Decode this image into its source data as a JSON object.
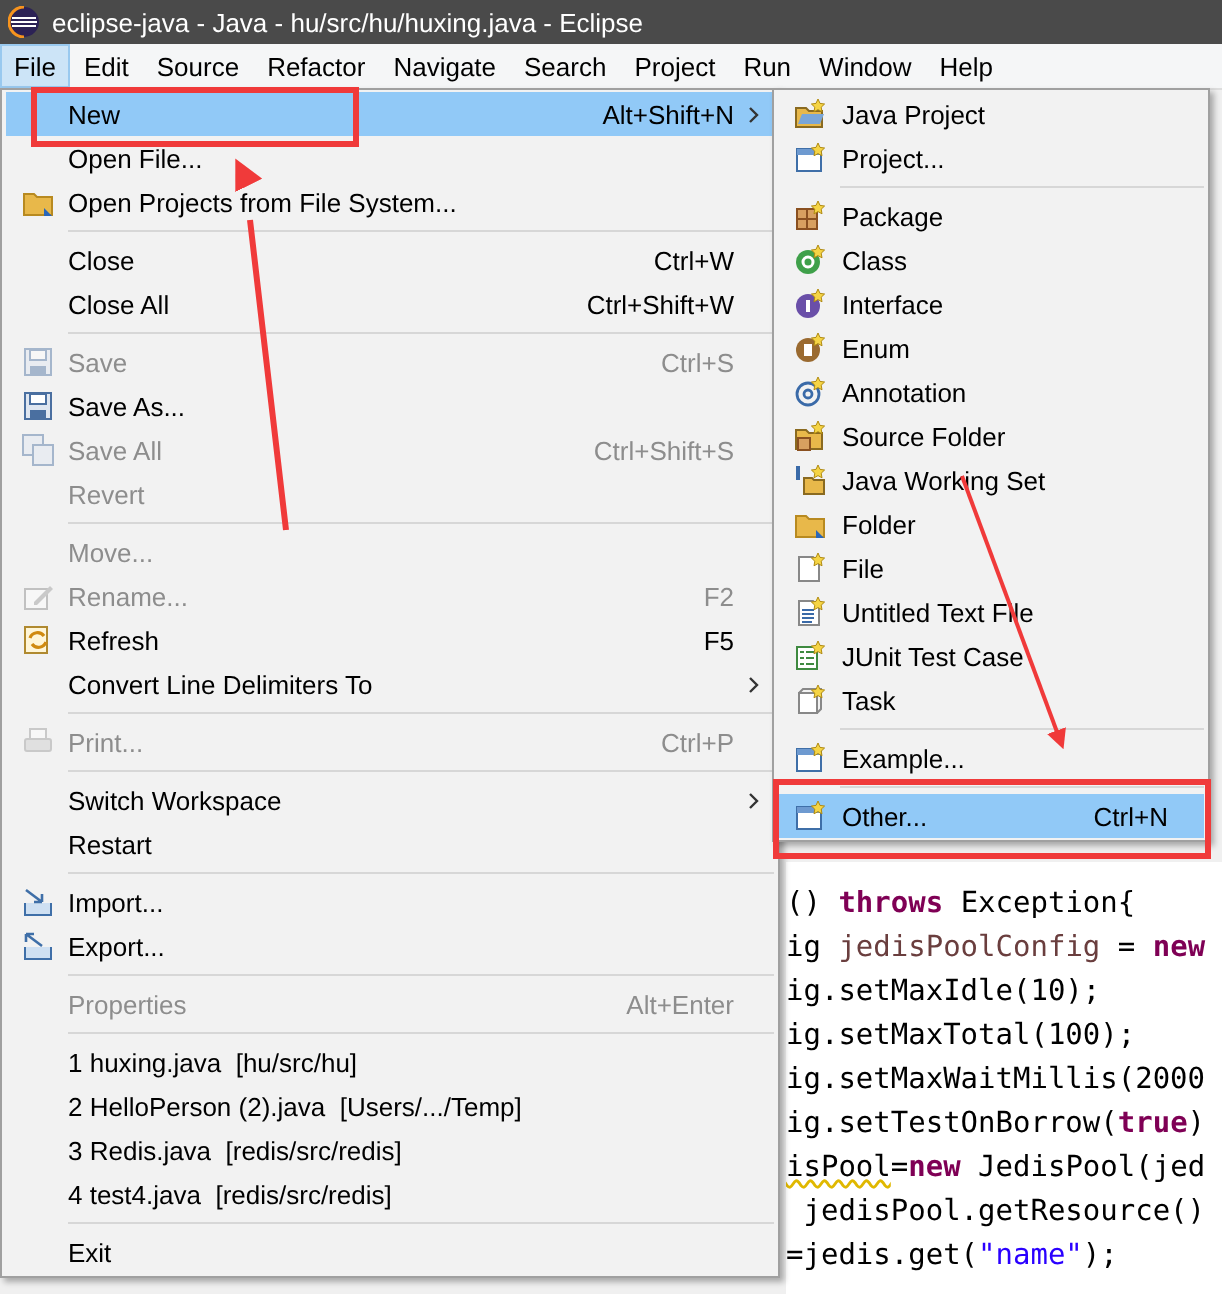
{
  "window": {
    "title": "eclipse-java - Java - hu/src/hu/huxing.java - Eclipse"
  },
  "menubar": [
    {
      "label": "File",
      "selected": true
    },
    {
      "label": "Edit",
      "selected": false
    },
    {
      "label": "Source",
      "selected": false
    },
    {
      "label": "Refactor",
      "selected": false
    },
    {
      "label": "Navigate",
      "selected": false
    },
    {
      "label": "Search",
      "selected": false
    },
    {
      "label": "Project",
      "selected": false
    },
    {
      "label": "Run",
      "selected": false
    },
    {
      "label": "Window",
      "selected": false
    },
    {
      "label": "Help",
      "selected": false
    }
  ],
  "file_menu": {
    "items": [
      {
        "kind": "item",
        "label": "New",
        "shortcut": "Alt+Shift+N",
        "submenu": true,
        "selected": true,
        "disabled": false
      },
      {
        "kind": "item",
        "label": "Open File...",
        "submenu": false,
        "selected": false,
        "disabled": false
      },
      {
        "kind": "item",
        "label": "Open Projects from File System...",
        "submenu": false,
        "selected": false,
        "disabled": false
      },
      {
        "kind": "separator"
      },
      {
        "kind": "item",
        "label": "Close",
        "shortcut": "Ctrl+W",
        "submenu": false,
        "selected": false,
        "disabled": false
      },
      {
        "kind": "item",
        "label": "Close All",
        "shortcut": "Ctrl+Shift+W",
        "submenu": false,
        "selected": false,
        "disabled": false
      },
      {
        "kind": "separator"
      },
      {
        "kind": "item",
        "label": "Save",
        "shortcut": "Ctrl+S",
        "submenu": false,
        "selected": false,
        "disabled": true
      },
      {
        "kind": "item",
        "label": "Save As...",
        "submenu": false,
        "selected": false,
        "disabled": false
      },
      {
        "kind": "item",
        "label": "Save All",
        "shortcut": "Ctrl+Shift+S",
        "submenu": false,
        "selected": false,
        "disabled": true
      },
      {
        "kind": "item",
        "label": "Revert",
        "submenu": false,
        "selected": false,
        "disabled": true
      },
      {
        "kind": "separator"
      },
      {
        "kind": "item",
        "label": "Move...",
        "submenu": false,
        "selected": false,
        "disabled": true
      },
      {
        "kind": "item",
        "label": "Rename...",
        "shortcut": "F2",
        "submenu": false,
        "selected": false,
        "disabled": true
      },
      {
        "kind": "item",
        "label": "Refresh",
        "shortcut": "F5",
        "submenu": false,
        "selected": false,
        "disabled": false
      },
      {
        "kind": "item",
        "label": "Convert Line Delimiters To",
        "submenu": true,
        "selected": false,
        "disabled": false
      },
      {
        "kind": "separator"
      },
      {
        "kind": "item",
        "label": "Print...",
        "shortcut": "Ctrl+P",
        "submenu": false,
        "selected": false,
        "disabled": true
      },
      {
        "kind": "separator"
      },
      {
        "kind": "item",
        "label": "Switch Workspace",
        "submenu": true,
        "selected": false,
        "disabled": false
      },
      {
        "kind": "item",
        "label": "Restart",
        "submenu": false,
        "selected": false,
        "disabled": false
      },
      {
        "kind": "separator"
      },
      {
        "kind": "item",
        "label": "Import...",
        "submenu": false,
        "selected": false,
        "disabled": false
      },
      {
        "kind": "item",
        "label": "Export...",
        "submenu": false,
        "selected": false,
        "disabled": false
      },
      {
        "kind": "separator"
      },
      {
        "kind": "item",
        "label": "Properties",
        "shortcut": "Alt+Enter",
        "submenu": false,
        "selected": false,
        "disabled": true
      },
      {
        "kind": "separator"
      },
      {
        "kind": "item",
        "label": "1 huxing.java  [hu/src/hu]",
        "submenu": false,
        "selected": false,
        "disabled": false
      },
      {
        "kind": "item",
        "label": "2 HelloPerson (2).java  [Users/.../Temp]",
        "submenu": false,
        "selected": false,
        "disabled": false
      },
      {
        "kind": "item",
        "label": "3 Redis.java  [redis/src/redis]",
        "submenu": false,
        "selected": false,
        "disabled": false
      },
      {
        "kind": "item",
        "label": "4 test4.java  [redis/src/redis]",
        "submenu": false,
        "selected": false,
        "disabled": false
      },
      {
        "kind": "separator"
      },
      {
        "kind": "item",
        "label": "Exit",
        "submenu": false,
        "selected": false,
        "disabled": false
      }
    ]
  },
  "new_submenu": {
    "items": [
      {
        "kind": "item",
        "label": "Java Project",
        "selected": false
      },
      {
        "kind": "item",
        "label": "Project...",
        "selected": false
      },
      {
        "kind": "separator"
      },
      {
        "kind": "item",
        "label": "Package",
        "selected": false
      },
      {
        "kind": "item",
        "label": "Class",
        "selected": false
      },
      {
        "kind": "item",
        "label": "Interface",
        "selected": false
      },
      {
        "kind": "item",
        "label": "Enum",
        "selected": false
      },
      {
        "kind": "item",
        "label": "Annotation",
        "selected": false
      },
      {
        "kind": "item",
        "label": "Source Folder",
        "selected": false
      },
      {
        "kind": "item",
        "label": "Java Working Set",
        "selected": false
      },
      {
        "kind": "item",
        "label": "Folder",
        "selected": false
      },
      {
        "kind": "item",
        "label": "File",
        "selected": false
      },
      {
        "kind": "item",
        "label": "Untitled Text File",
        "selected": false
      },
      {
        "kind": "item",
        "label": "JUnit Test Case",
        "selected": false
      },
      {
        "kind": "item",
        "label": "Task",
        "selected": false
      },
      {
        "kind": "separator"
      },
      {
        "kind": "item",
        "label": "Example...",
        "selected": false
      },
      {
        "kind": "separator"
      },
      {
        "kind": "item",
        "label": "Other...",
        "shortcut": "Ctrl+N",
        "selected": true
      }
    ]
  },
  "editor": {
    "lines": [
      [
        {
          "kind": "plain",
          "text": "() "
        },
        {
          "kind": "keyword",
          "text": "throws"
        },
        {
          "kind": "plain",
          "text": " Exception{"
        }
      ],
      [
        {
          "kind": "plain",
          "text": "ig "
        },
        {
          "kind": "variable",
          "text": "jedisPoolConfig"
        },
        {
          "kind": "plain",
          "text": " = "
        },
        {
          "kind": "keyword",
          "text": "new"
        }
      ],
      [
        {
          "kind": "plain",
          "text": "ig.setMaxIdle(10);"
        }
      ],
      [
        {
          "kind": "plain",
          "text": "ig.setMaxTotal(100);"
        }
      ],
      [
        {
          "kind": "plain",
          "text": "ig.setMaxWaitMillis(2000"
        }
      ],
      [
        {
          "kind": "plain",
          "text": "ig.setTestOnBorrow("
        },
        {
          "kind": "keyword",
          "text": "true"
        },
        {
          "kind": "plain",
          "text": ")"
        }
      ],
      [
        {
          "kind": "warning",
          "text": "isPool"
        },
        {
          "kind": "plain",
          "text": "="
        },
        {
          "kind": "keyword",
          "text": "new"
        },
        {
          "kind": "plain",
          "text": " JedisPool(jed"
        }
      ],
      [
        {
          "kind": "plain",
          "text": " jedisPool.getResource()"
        }
      ],
      [
        {
          "kind": "plain",
          "text": "=jedis.get("
        },
        {
          "kind": "string",
          "text": "\"name\""
        },
        {
          "kind": "plain",
          "text": ");"
        }
      ]
    ]
  }
}
